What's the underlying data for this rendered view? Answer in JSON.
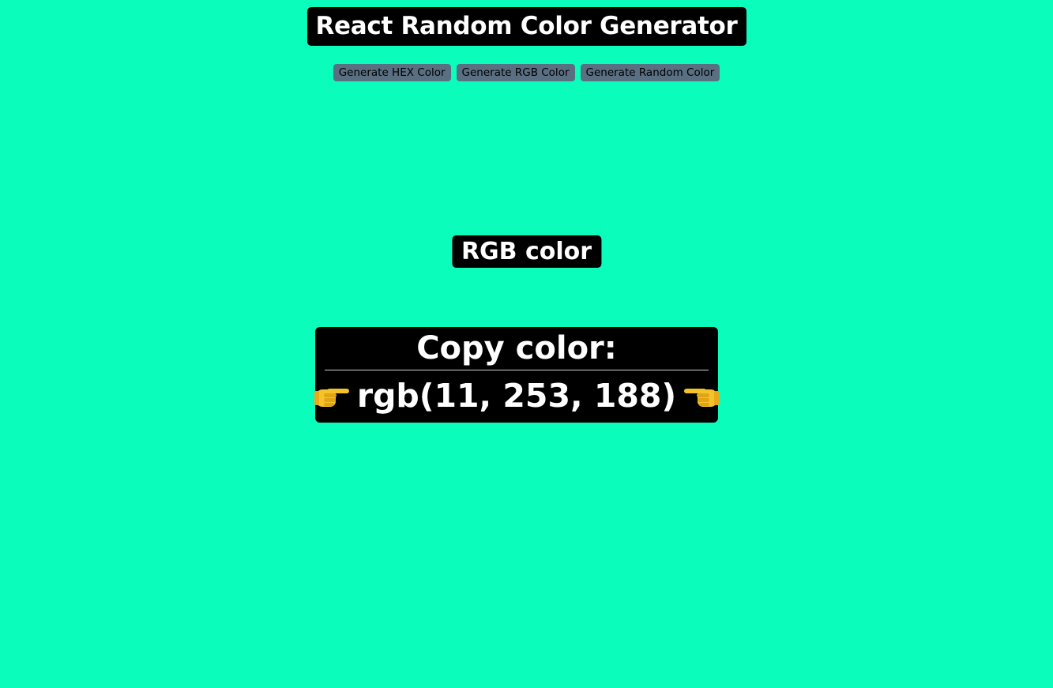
{
  "colors": {
    "background": "#0bfdbc",
    "panel": "#000000",
    "button": "#5a6f82"
  },
  "header": {
    "title": "React Random Color Generator"
  },
  "toolbar": {
    "hex_label": "Generate HEX Color",
    "rgb_label": "Generate RGB Color",
    "random_label": "Generate Random Color"
  },
  "display": {
    "mode_label": "RGB color",
    "copy_heading": "Copy color:",
    "color_value": "rgb(11, 253, 188)",
    "left_icon": "pointing-right-hand-icon",
    "right_icon": "pointing-left-hand-icon"
  }
}
